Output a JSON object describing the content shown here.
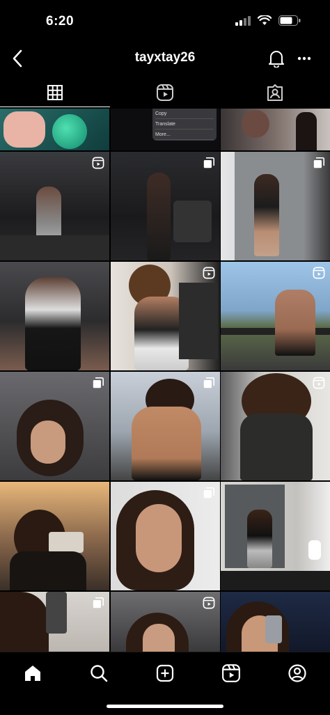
{
  "status_bar": {
    "time": "6:20"
  },
  "header": {
    "username": "tayxtay26"
  },
  "tabs": [
    {
      "name": "posts-grid",
      "icon": "grid-icon",
      "active": true
    },
    {
      "name": "reels",
      "icon": "reels-icon",
      "active": false
    },
    {
      "name": "tagged",
      "icon": "tagged-icon",
      "active": false
    }
  ],
  "context_menu": {
    "items": [
      "Copy",
      "Translate",
      "More..."
    ]
  },
  "grid_tiles": [
    {
      "badge": "none",
      "theme": "drink"
    },
    {
      "badge": "none",
      "theme": "screenshot-menu"
    },
    {
      "badge": "none",
      "theme": "mural"
    },
    {
      "badge": "reel-icon",
      "theme": "gym"
    },
    {
      "badge": "carousel-icon",
      "theme": "gym-dark"
    },
    {
      "badge": "carousel-icon",
      "theme": "locker-mirror"
    },
    {
      "badge": "none",
      "theme": "locker-flex"
    },
    {
      "badge": "reel-icon",
      "theme": "skeleton-tapestry"
    },
    {
      "badge": "reel-icon",
      "theme": "balcony"
    },
    {
      "badge": "carousel-icon",
      "theme": "selfie-couch"
    },
    {
      "badge": "carousel-icon",
      "theme": "outdoor-drink"
    },
    {
      "badge": "reel-icon",
      "theme": "mirror-tshirt"
    },
    {
      "badge": "none",
      "theme": "balcony-sunset"
    },
    {
      "badge": "carousel-icon",
      "theme": "closeup"
    },
    {
      "badge": "none",
      "theme": "bathroom-mirror"
    },
    {
      "badge": "carousel-icon",
      "theme": "mirror-selfie"
    },
    {
      "badge": "reel-icon",
      "theme": "curly-portrait"
    },
    {
      "badge": "none",
      "theme": "blue-selfie"
    }
  ],
  "bottom_nav": [
    {
      "name": "home",
      "icon": "home-icon"
    },
    {
      "name": "search",
      "icon": "search-icon"
    },
    {
      "name": "create",
      "icon": "create-icon"
    },
    {
      "name": "reels",
      "icon": "reels-icon"
    },
    {
      "name": "profile",
      "icon": "profile-icon"
    }
  ]
}
